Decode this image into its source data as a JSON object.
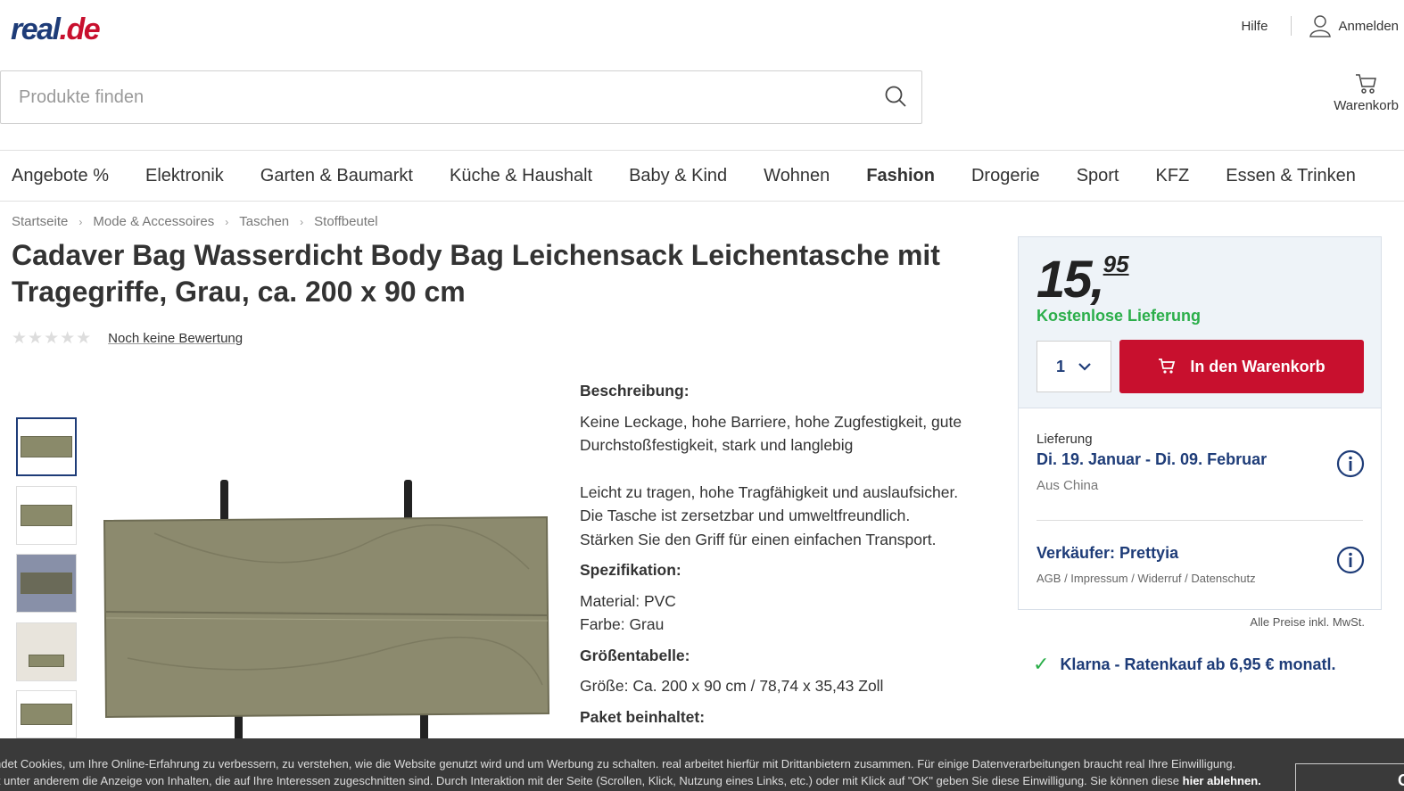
{
  "header": {
    "logo_main": "real",
    "logo_dot": ".",
    "logo_de": "de",
    "help": "Hilfe",
    "login": "Anmelden",
    "search_placeholder": "Produkte finden",
    "cart": "Warenkorb"
  },
  "nav": [
    "Angebote %",
    "Elektronik",
    "Garten & Baumarkt",
    "Küche & Haushalt",
    "Baby & Kind",
    "Wohnen",
    "Fashion",
    "Drogerie",
    "Sport",
    "KFZ",
    "Essen & Trinken"
  ],
  "nav_active": "Fashion",
  "breadcrumb": [
    "Startseite",
    "Mode & Accessoires",
    "Taschen",
    "Stoffbeutel"
  ],
  "product": {
    "title": "Cadaver Bag Wasserdicht Body Bag Leichensack Leichentasche mit Tragegriffe, Grau, ca. 200 x 90 cm",
    "rating_text": "Noch keine Bewertung",
    "stars": "★★★★★"
  },
  "description": {
    "h_desc": "Beschreibung:",
    "p1": "Keine Leckage, hohe Barriere, hohe Zugfestigkeit, gute Durchstoßfestigkeit, stark und langlebig",
    "p2_l1": "Leicht zu tragen, hohe Tragfähigkeit und auslaufsicher.",
    "p2_l2": "Die Tasche ist zersetzbar und umweltfreundlich.",
    "p2_l3": "Stärken Sie den Griff für einen einfachen Transport.",
    "h_spec": "Spezifikation:",
    "material": "Material: PVC",
    "color": "Farbe: Grau",
    "h_size": "Größentabelle:",
    "size": "Größe: Ca. 200 x 90 cm / 78,74 x 35,43 Zoll",
    "h_pkg": "Paket beinhaltet:"
  },
  "buybox": {
    "price_main": "15,",
    "price_cents": "95",
    "free_delivery": "Kostenlose Lieferung",
    "quantity": "1",
    "add_to_cart": "In den Warenkorb",
    "delivery_label": "Lieferung",
    "delivery_dates": "Di. 19. Januar - Di. 09. Februar",
    "origin": "Aus China",
    "seller": "Verkäufer: Prettyia",
    "seller_links": "AGB / Impressum / Widerruf / Datenschutz"
  },
  "vat_note": "Alle Preise inkl. MwSt.",
  "klarna": "Klarna - Ratenkauf ab 6,95 € monatl.",
  "cookie": {
    "line1": "ndet Cookies, um Ihre Online-Erfahrung zu verbessern, zu verstehen, wie die Website genutzt wird und um Werbung zu schalten. real arbeitet hierfür mit Drittanbietern zusammen. Für einige Datenverarbeitungen braucht real Ihre Einwilligung.",
    "line2": "lt unter anderem die Anzeige von Inhalten, die auf Ihre Interessen zugeschnitten sind. Durch Interaktion mit der Seite (Scrollen, Klick, Nutzung eines Links, etc.) oder mit Klick auf \"OK\" geben Sie diese Einwilligung. Sie können diese",
    "decline": "hier ablehnen.",
    "ok": "OK"
  },
  "colors": {
    "brand_blue": "#1e3c78",
    "brand_red": "#c8102e",
    "green": "#2bae4a"
  }
}
